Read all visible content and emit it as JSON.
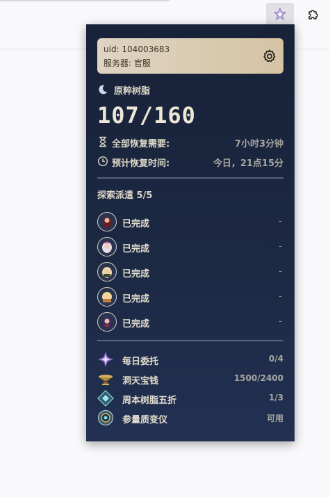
{
  "popup": {
    "user": {
      "uid_text": "uid: 104003683",
      "server_text": "服务器: 官服"
    },
    "resin": {
      "title": "原粹树脂",
      "value": "107/160",
      "full_recovery_label": "全部恢复需要:",
      "full_recovery_value": "7小时3分钟",
      "eta_label": "预计恢复时间:",
      "eta_value": "今日，21点15分"
    },
    "expeditions": {
      "title": "探索派遣 5/5",
      "items": [
        {
          "status": "已完成",
          "remaining": "-"
        },
        {
          "status": "已完成",
          "remaining": "-"
        },
        {
          "status": "已完成",
          "remaining": "-"
        },
        {
          "status": "已完成",
          "remaining": "-"
        },
        {
          "status": "已完成",
          "remaining": "-"
        }
      ]
    },
    "notes": [
      {
        "label": "每日委托",
        "value": "0/4",
        "icon": "daily-commission-icon"
      },
      {
        "label": "洞天宝钱",
        "value": "1500/2400",
        "icon": "realm-currency-icon"
      },
      {
        "label": "周本树脂五折",
        "value": "1/3",
        "icon": "weekly-boss-discount-icon"
      },
      {
        "label": "参量质变仪",
        "value": "可用",
        "icon": "parametric-transformer-icon"
      }
    ]
  },
  "colors": {
    "popup_bg_top": "#182238",
    "popup_bg_bottom": "#223052",
    "card_bg": "#dfd4c2",
    "text_primary": "#e9e3d3"
  }
}
